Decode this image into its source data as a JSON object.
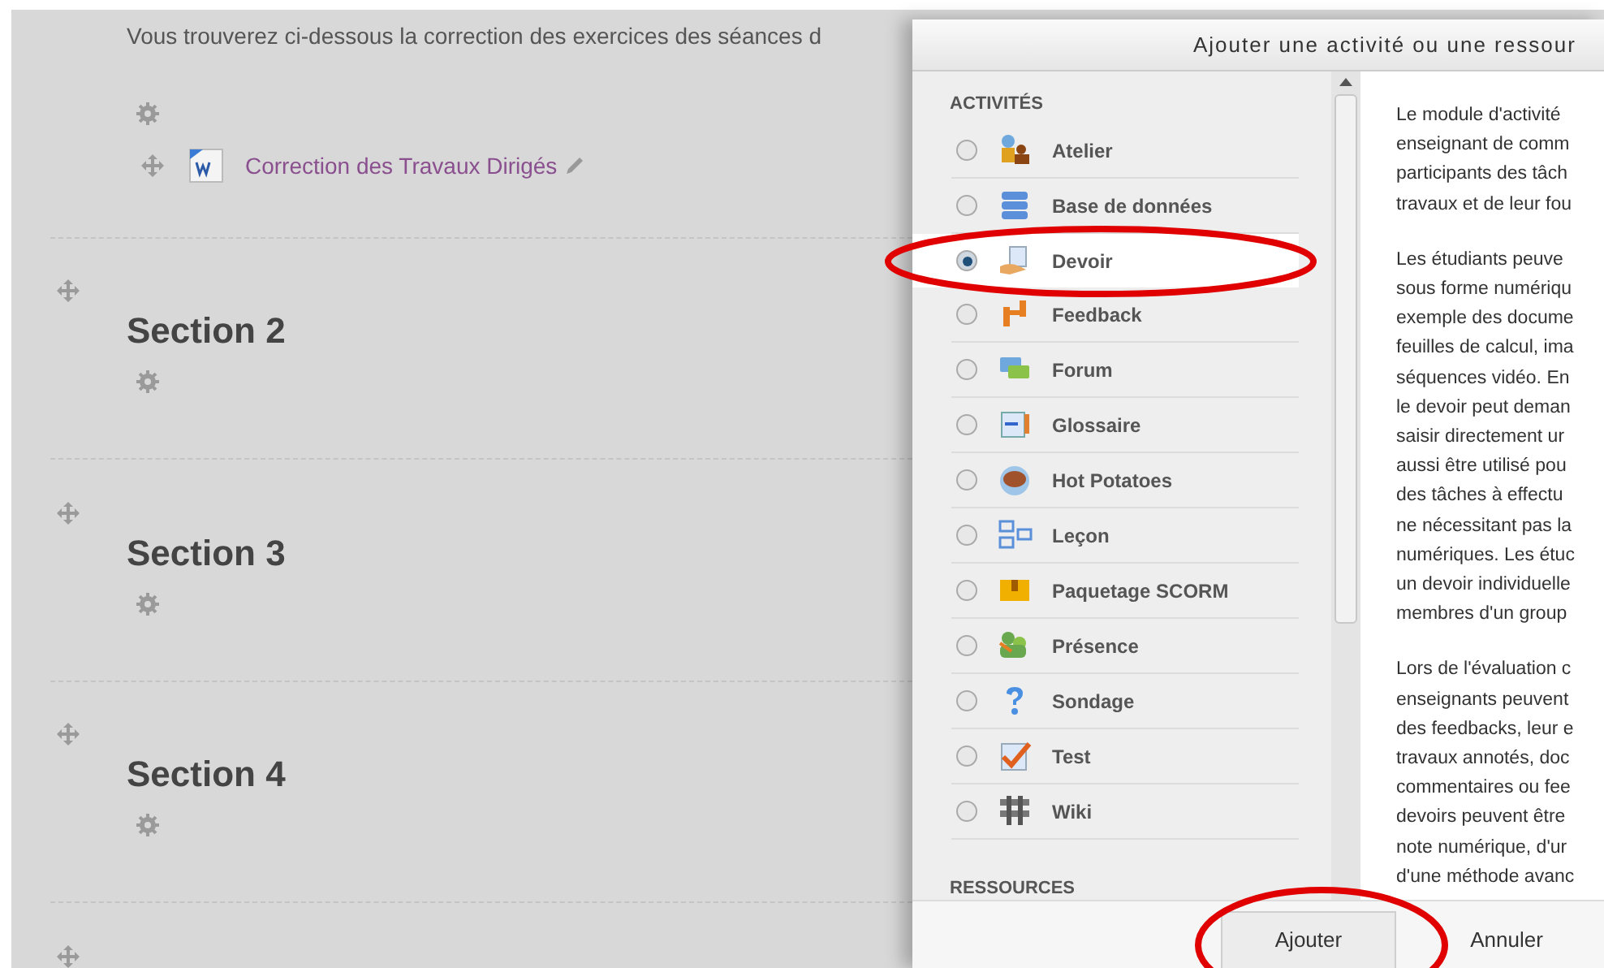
{
  "course": {
    "intro": "Vous trouverez ci-dessous la correction des exercices des séances d",
    "resource_link": "Correction des Travaux Dirigés",
    "sections": [
      {
        "title": "Section 2"
      },
      {
        "title": "Section 3"
      },
      {
        "title": "Section 4"
      }
    ]
  },
  "dialog": {
    "title": "Ajouter une activité ou une ressour",
    "activities_heading": "ACTIVITÉS",
    "activities": [
      {
        "label": "Atelier",
        "selected": false
      },
      {
        "label": "Base de données",
        "selected": false
      },
      {
        "label": "Devoir",
        "selected": true
      },
      {
        "label": "Feedback",
        "selected": false
      },
      {
        "label": "Forum",
        "selected": false
      },
      {
        "label": "Glossaire",
        "selected": false
      },
      {
        "label": "Hot Potatoes",
        "selected": false
      },
      {
        "label": "Leçon",
        "selected": false
      },
      {
        "label": "Paquetage SCORM",
        "selected": false
      },
      {
        "label": "Présence",
        "selected": false
      },
      {
        "label": "Sondage",
        "selected": false
      },
      {
        "label": "Test",
        "selected": false
      },
      {
        "label": "Wiki",
        "selected": false
      }
    ],
    "resources_heading": "RESSOURCES",
    "description": [
      [
        "Le module d'activité",
        "enseignant de comm",
        "participants des tâch",
        "travaux et de leur fou"
      ],
      [
        "Les étudiants peuve",
        "sous forme numériqu",
        "exemple des docume",
        "feuilles de calcul, ima",
        "séquences vidéo. En",
        "le devoir peut deman",
        "saisir directement ur",
        "aussi être utilisé pou",
        "des tâches à effectu",
        "ne nécessitant pas la",
        "numériques. Les étuc",
        "un devoir individuelle",
        "membres d'un group"
      ],
      [
        "Lors de l'évaluation c",
        "enseignants peuvent",
        "des feedbacks, leur e",
        "travaux annotés, doc",
        "commentaires ou fee",
        "devoirs peuvent être",
        "note numérique, d'ur",
        "d'une méthode avanc"
      ]
    ],
    "buttons": [
      "Ajouter",
      "Annuler"
    ]
  }
}
